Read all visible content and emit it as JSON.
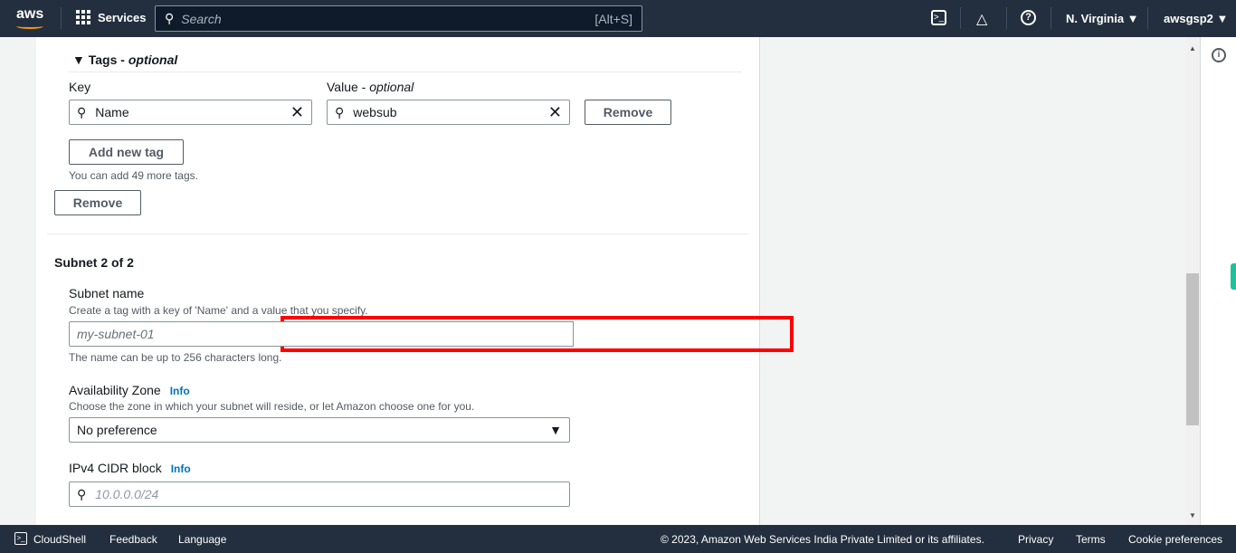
{
  "topbar": {
    "logo": "aws",
    "services": "Services",
    "search_placeholder": "Search",
    "search_shortcut": "[Alt+S]",
    "region": "N. Virginia",
    "account": "awsgsp2"
  },
  "tags": {
    "header": "Tags",
    "header_optional": "optional",
    "key_label": "Key",
    "value_label": "Value",
    "value_optional": "optional",
    "key_value": "Name",
    "value_value": "websub",
    "remove_tag": "Remove",
    "add_tag": "Add new tag",
    "limit_text": "You can add 49 more tags.",
    "remove_subnet": "Remove"
  },
  "subnet": {
    "title": "Subnet 2 of 2",
    "name_label": "Subnet name",
    "name_desc": "Create a tag with a key of 'Name' and a value that you specify.",
    "name_placeholder": "my-subnet-01",
    "name_hint": "The name can be up to 256 characters long.",
    "az_label": "Availability Zone",
    "az_info": "Info",
    "az_desc": "Choose the zone in which your subnet will reside, or let Amazon choose one for you.",
    "az_value": "No preference",
    "cidr_label": "IPv4 CIDR block",
    "cidr_info": "Info",
    "cidr_placeholder": "10.0.0.0/24"
  },
  "footer": {
    "cloudshell": "CloudShell",
    "feedback": "Feedback",
    "language": "Language",
    "copyright": "© 2023, Amazon Web Services India Private Limited or its affiliates.",
    "privacy": "Privacy",
    "terms": "Terms",
    "cookies": "Cookie preferences"
  },
  "colors": {
    "nav_bg": "#232f3e",
    "link": "#0073bb",
    "highlight": "#ff0000"
  }
}
